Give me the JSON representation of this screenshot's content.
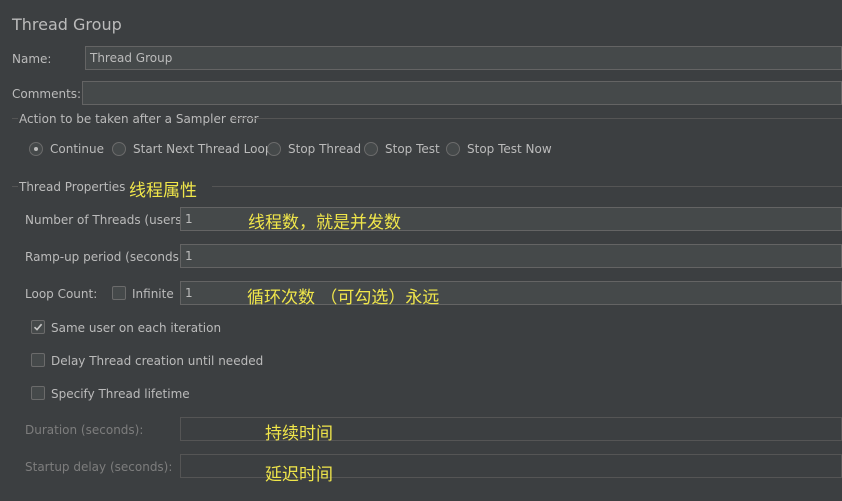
{
  "header": {
    "title": "Thread Group"
  },
  "name": {
    "label": "Name:",
    "value": "Thread Group"
  },
  "comments": {
    "label": "Comments:",
    "value": ""
  },
  "sampler_error": {
    "legend": "Action to be taken after a Sampler error",
    "options": [
      {
        "label": "Continue",
        "selected": true
      },
      {
        "label": "Start Next Thread Loop",
        "selected": false
      },
      {
        "label": "Stop Thread",
        "selected": false
      },
      {
        "label": "Stop Test",
        "selected": false
      },
      {
        "label": "Stop Test Now",
        "selected": false
      }
    ]
  },
  "thread_properties": {
    "legend": "Thread Properties",
    "annotation": "线程属性",
    "num_threads": {
      "label": "Number of Threads (users):",
      "value": "1",
      "annotation": "线程数，就是并发数"
    },
    "ramp_up": {
      "label": "Ramp-up period (seconds):",
      "value": "1"
    },
    "loop_count": {
      "label": "Loop Count:",
      "infinite_label": "Infinite",
      "infinite_checked": false,
      "value": "1",
      "annotation": "循环次数 （可勾选）永远"
    },
    "same_user": {
      "label": "Same user on each iteration",
      "checked": true
    },
    "delay_creation": {
      "label": "Delay Thread creation until needed",
      "checked": false
    },
    "specify_lifetime": {
      "label": "Specify Thread lifetime",
      "checked": false
    },
    "duration": {
      "label": "Duration (seconds):",
      "value": "",
      "annotation": "持续时间"
    },
    "startup_delay": {
      "label": "Startup delay (seconds):",
      "value": "",
      "annotation": "延迟时间"
    }
  },
  "colors": {
    "background": "#3c3f41",
    "field": "#45494a",
    "text": "#bbbbbb",
    "annotation": "#f0e64a"
  }
}
